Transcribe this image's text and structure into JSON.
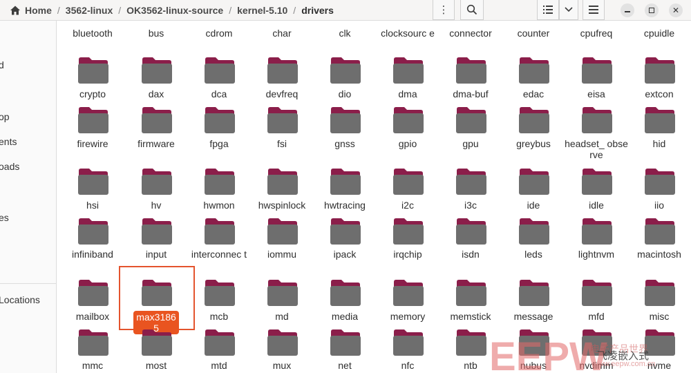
{
  "breadcrumbs": [
    "Home",
    "3562-linux",
    "OK3562-linux-source",
    "kernel-5.10",
    "drivers"
  ],
  "sidebar": {
    "items": [
      "d",
      "op",
      "ents",
      "oads",
      "es",
      "Locations"
    ]
  },
  "folders_row1": [
    "bluetooth",
    "bus",
    "cdrom",
    "char",
    "clk",
    "clocksourc e",
    "connector",
    "counter",
    "cpufreq",
    "cpuidle"
  ],
  "folders_row2": [
    "crypto",
    "dax",
    "dca",
    "devfreq",
    "dio",
    "dma",
    "dma-buf",
    "edac",
    "eisa",
    "extcon"
  ],
  "folders_row3": [
    "firewire",
    "firmware",
    "fpga",
    "fsi",
    "gnss",
    "gpio",
    "gpu",
    "greybus",
    "headset_ observe",
    "hid"
  ],
  "folders_row4": [
    "hsi",
    "hv",
    "hwmon",
    "hwspinlock",
    "hwtracing",
    "i2c",
    "i3c",
    "ide",
    "idle",
    "iio"
  ],
  "folders_row5": [
    "infiniband",
    "input",
    "interconnec t",
    "iommu",
    "ipack",
    "irqchip",
    "isdn",
    "leds",
    "lightnvm",
    "macintosh"
  ],
  "folders_row6": [
    "mailbox",
    "max31865",
    "mcb",
    "md",
    "media",
    "memory",
    "memstick",
    "message",
    "mfd",
    "misc"
  ],
  "folders_row7": [
    "mmc",
    "most",
    "mtd",
    "mux",
    "net",
    "nfc",
    "ntb",
    "nubus",
    "nvdimm",
    "nvme"
  ],
  "selected_folder": "max31865",
  "watermark": {
    "text": "EEPW",
    "sub": "电子产品世界",
    "sub2": "www.eepw.com.cn",
    "overlay": "飞凌嵌入式"
  },
  "colors": {
    "folder_body": "#6e6e6e",
    "folder_tab": "#8b1e4a",
    "selection": "#e95420"
  }
}
